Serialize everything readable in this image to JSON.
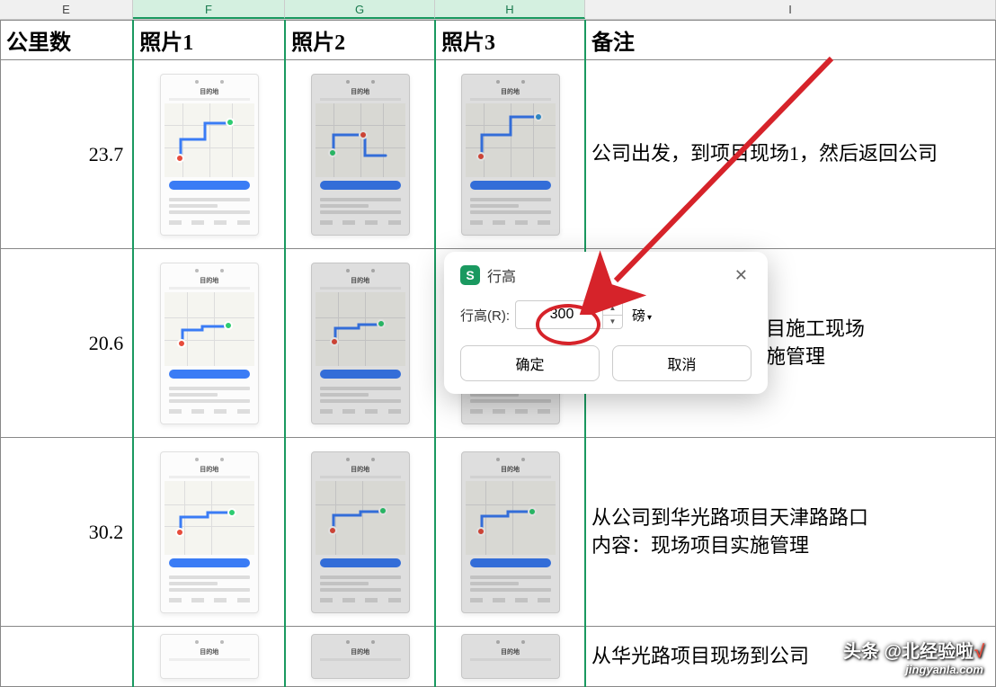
{
  "columns": {
    "E": "E",
    "F": "F",
    "G": "G",
    "H": "H",
    "I": "I"
  },
  "headers": {
    "E": "公里数",
    "F": "照片1",
    "G": "照片2",
    "H": "照片3",
    "I": "备注"
  },
  "rows": [
    {
      "km": "23.7",
      "note": "公司出发，到项目现场1，然后返回公司"
    },
    {
      "km": "20.6",
      "note": "目施工现场\n施管理"
    },
    {
      "km": "30.2",
      "note": "从公司到华光路项目天津路路口\n内容：现场项目实施管理"
    }
  ],
  "partial_note": "从华光路项目现场到公司",
  "dialog": {
    "title": "行高",
    "label": "行高(R):",
    "value": "300",
    "unit": "磅",
    "ok": "确定",
    "cancel": "取消"
  },
  "watermark": {
    "line1": "头条 @北经验啦",
    "check": "√",
    "line2": "jingyanla.com"
  }
}
